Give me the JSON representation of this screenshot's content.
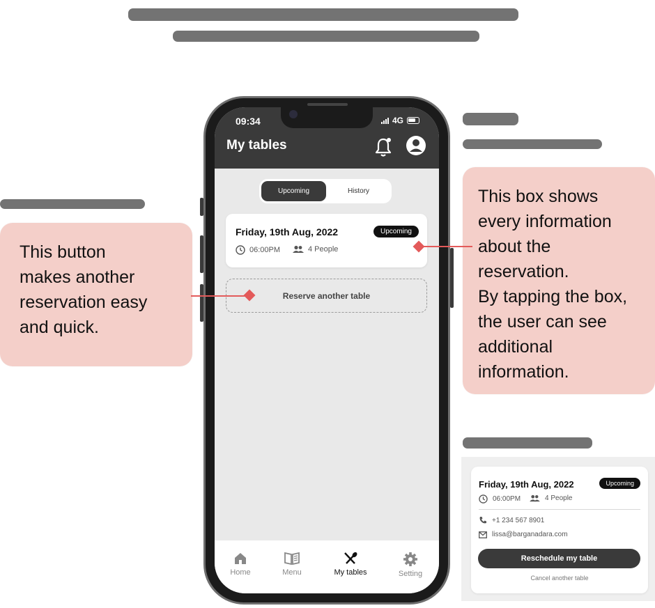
{
  "app": {
    "status_time": "09:34",
    "network": "4G",
    "title": "My tables"
  },
  "segmented": {
    "active": "Upcoming",
    "inactive": "History"
  },
  "reservation": {
    "date": "Friday, 19th Aug, 2022",
    "badge": "Upcoming",
    "time": "06:00PM",
    "people": "4 People"
  },
  "reserve_button": "Reserve another table",
  "tabs": [
    {
      "label": "Home",
      "icon": "home-icon"
    },
    {
      "label": "Menu",
      "icon": "book-icon"
    },
    {
      "label": "My tables",
      "icon": "cutlery-icon"
    },
    {
      "label": "Setting",
      "icon": "gear-icon"
    }
  ],
  "callouts": {
    "left": [
      "This button",
      "makes another",
      "reservation easy",
      "and quick."
    ],
    "right": [
      "This box shows",
      "every information",
      "about the",
      "reservation.",
      "By tapping the box,",
      "the user can see",
      "additional",
      "information."
    ]
  },
  "detail": {
    "date": "Friday, 19th Aug, 2022",
    "badge": "Upcoming",
    "time": "06:00PM",
    "people": "4 People",
    "phone": "+1 234 567 8901",
    "email": "lissa@barganadara.com",
    "primary_button": "Reschedule my table",
    "secondary_link": "Cancel another table"
  },
  "colors": {
    "callout_bg": "#f4cfc9",
    "accent_line": "#e35a5a",
    "appbar": "#3a3a3a",
    "screen_bg": "#e9e9e9"
  }
}
